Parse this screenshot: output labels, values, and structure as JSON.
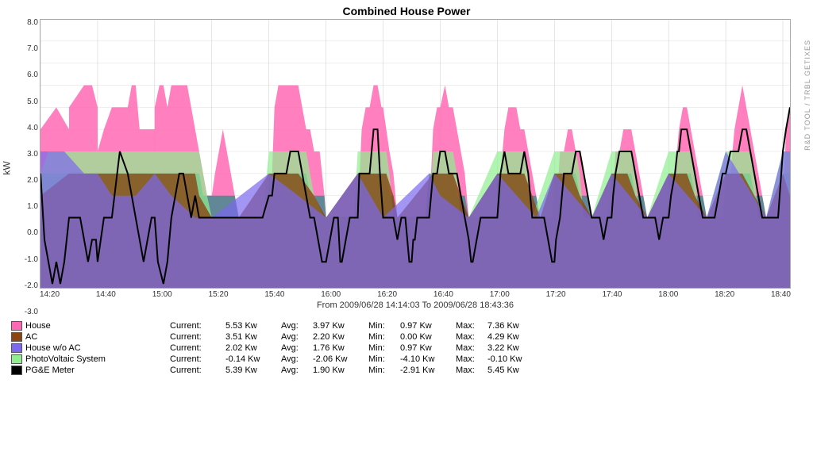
{
  "title": "Combined House Power",
  "chart": {
    "yAxis": {
      "title": "kW",
      "labels": [
        "8.0",
        "7.0",
        "6.0",
        "5.0",
        "4.0",
        "3.0",
        "2.0",
        "1.0",
        "0.0",
        "-1.0",
        "-2.0",
        "-3.0"
      ]
    },
    "xAxis": {
      "labels": [
        "14:20",
        "14:40",
        "15:00",
        "15:20",
        "15:40",
        "16:00",
        "16:20",
        "16:40",
        "17:00",
        "17:20",
        "17:40",
        "18:00",
        "18:20",
        "18:40"
      ]
    },
    "dateRange": "From 2009/06/28 14:14:03 To 2009/06/28 18:43:36"
  },
  "legend": [
    {
      "name": "House",
      "color": "#FF69B4",
      "current": "5.53 Kw",
      "avg": "3.97 Kw",
      "min": "0.97 Kw",
      "max": "7.36 Kw"
    },
    {
      "name": "AC",
      "color": "#8B4513",
      "current": "3.51 Kw",
      "avg": "2.20 Kw",
      "min": "0.00 Kw",
      "max": "4.29 Kw"
    },
    {
      "name": "House w/o AC",
      "color": "#6A5ACD",
      "current": "2.02 Kw",
      "avg": "1.76 Kw",
      "min": "0.97 Kw",
      "max": "3.22 Kw"
    },
    {
      "name": "PhotoVoltaic System",
      "color": "#90EE90",
      "current": "-0.14 Kw",
      "avg": "-2.06 Kw",
      "min": "-4.10 Kw",
      "max": "-0.10 Kw"
    },
    {
      "name": "PG&E Meter",
      "color": "#000000",
      "current": "5.39 Kw",
      "avg": "1.90 Kw",
      "min": "-2.91 Kw",
      "max": "5.45 Kw"
    }
  ],
  "sidebar": "R&D TOOL / TRBL GETIXES"
}
